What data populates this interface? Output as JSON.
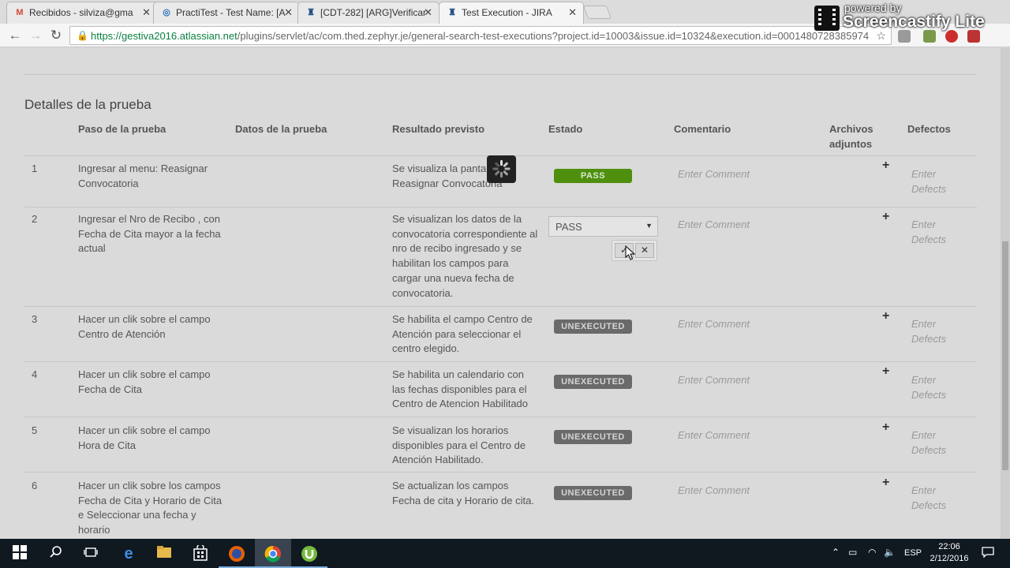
{
  "browser": {
    "tabs": [
      {
        "title": "Recibidos - silviza@gma",
        "favicon": "gmail-icon",
        "active": false
      },
      {
        "title": "PractiTest - Test Name: [A",
        "favicon": "practitest-icon",
        "active": false
      },
      {
        "title": "[CDT-282] [ARG]Verificar",
        "favicon": "jira-icon",
        "active": false
      },
      {
        "title": "Test Execution - JIRA",
        "favicon": "jira-icon",
        "active": true
      }
    ],
    "url_host": "https://gestiva2016.atlassian.net",
    "url_path": "/plugins/servlet/ac/com.thed.zephyr.je/general-search-test-executions?project.id=10003&issue.id=10324&execution.id=0001480728385974"
  },
  "overlay": {
    "powered_by": "powered by",
    "brand": "Screencastify Lite"
  },
  "section": {
    "title": "Detalles de la prueba"
  },
  "columns": {
    "step": "Paso de la prueba",
    "data": "Datos de la prueba",
    "expected": "Resultado previsto",
    "status": "Estado",
    "comment": "Comentario",
    "attachments_line1": "Archivos",
    "attachments_line2": "adjuntos",
    "defects": "Defectos"
  },
  "placeholders": {
    "comment": "Enter Comment",
    "defects_line1": "Enter",
    "defects_line2": "Defects",
    "add": "+"
  },
  "rows": [
    {
      "num": "1",
      "step": "Ingresar al menu: Reasignar Convocatoria",
      "expected": "Se visualiza la pantalla Reasignar Convocatoria",
      "status": "PASS"
    },
    {
      "num": "2",
      "step": "Ingresar el Nro de Recibo , con Fecha de Cita mayor a la fecha actual",
      "expected": "Se visualizan los datos de la convocatoria correspondiente al nro de recibo ingresado y se habilitan los campos para cargar una nueva fecha de convocatoria.",
      "status": "PASS"
    },
    {
      "num": "3",
      "step": "Hacer un clik sobre el campo Centro de Atención",
      "expected": "Se habilita el campo Centro de Atención para seleccionar el centro elegido.",
      "status": "UNEXECUTED"
    },
    {
      "num": "4",
      "step": "Hacer un clik sobre el campo Fecha de Cita",
      "expected": "Se habilita un calendario con las fechas disponibles para el Centro de Atencion Habilitado",
      "status": "UNEXECUTED"
    },
    {
      "num": "5",
      "step": "Hacer un clik sobre el campo Hora de Cita",
      "expected": "Se visualizan los horarios disponibles para el Centro de Atención Habilitado.",
      "status": "UNEXECUTED"
    },
    {
      "num": "6",
      "step": "Hacer un clik sobre los campos Fecha de Cita y Horario de Cita e Seleccionar una fecha y horario",
      "expected": "Se actualizan los campos Fecha de cita y Horario de cita.",
      "status": "UNEXECUTED"
    }
  ],
  "status_select": {
    "value": "PASS",
    "confirm": "✓",
    "cancel": "✕"
  },
  "taskbar": {
    "language": "ESP",
    "time": "22:06",
    "date": "2/12/2016"
  },
  "colors": {
    "pass": "#4e8f0e",
    "unexecuted": "#6a6a6a",
    "url_secure": "#0b8043"
  }
}
